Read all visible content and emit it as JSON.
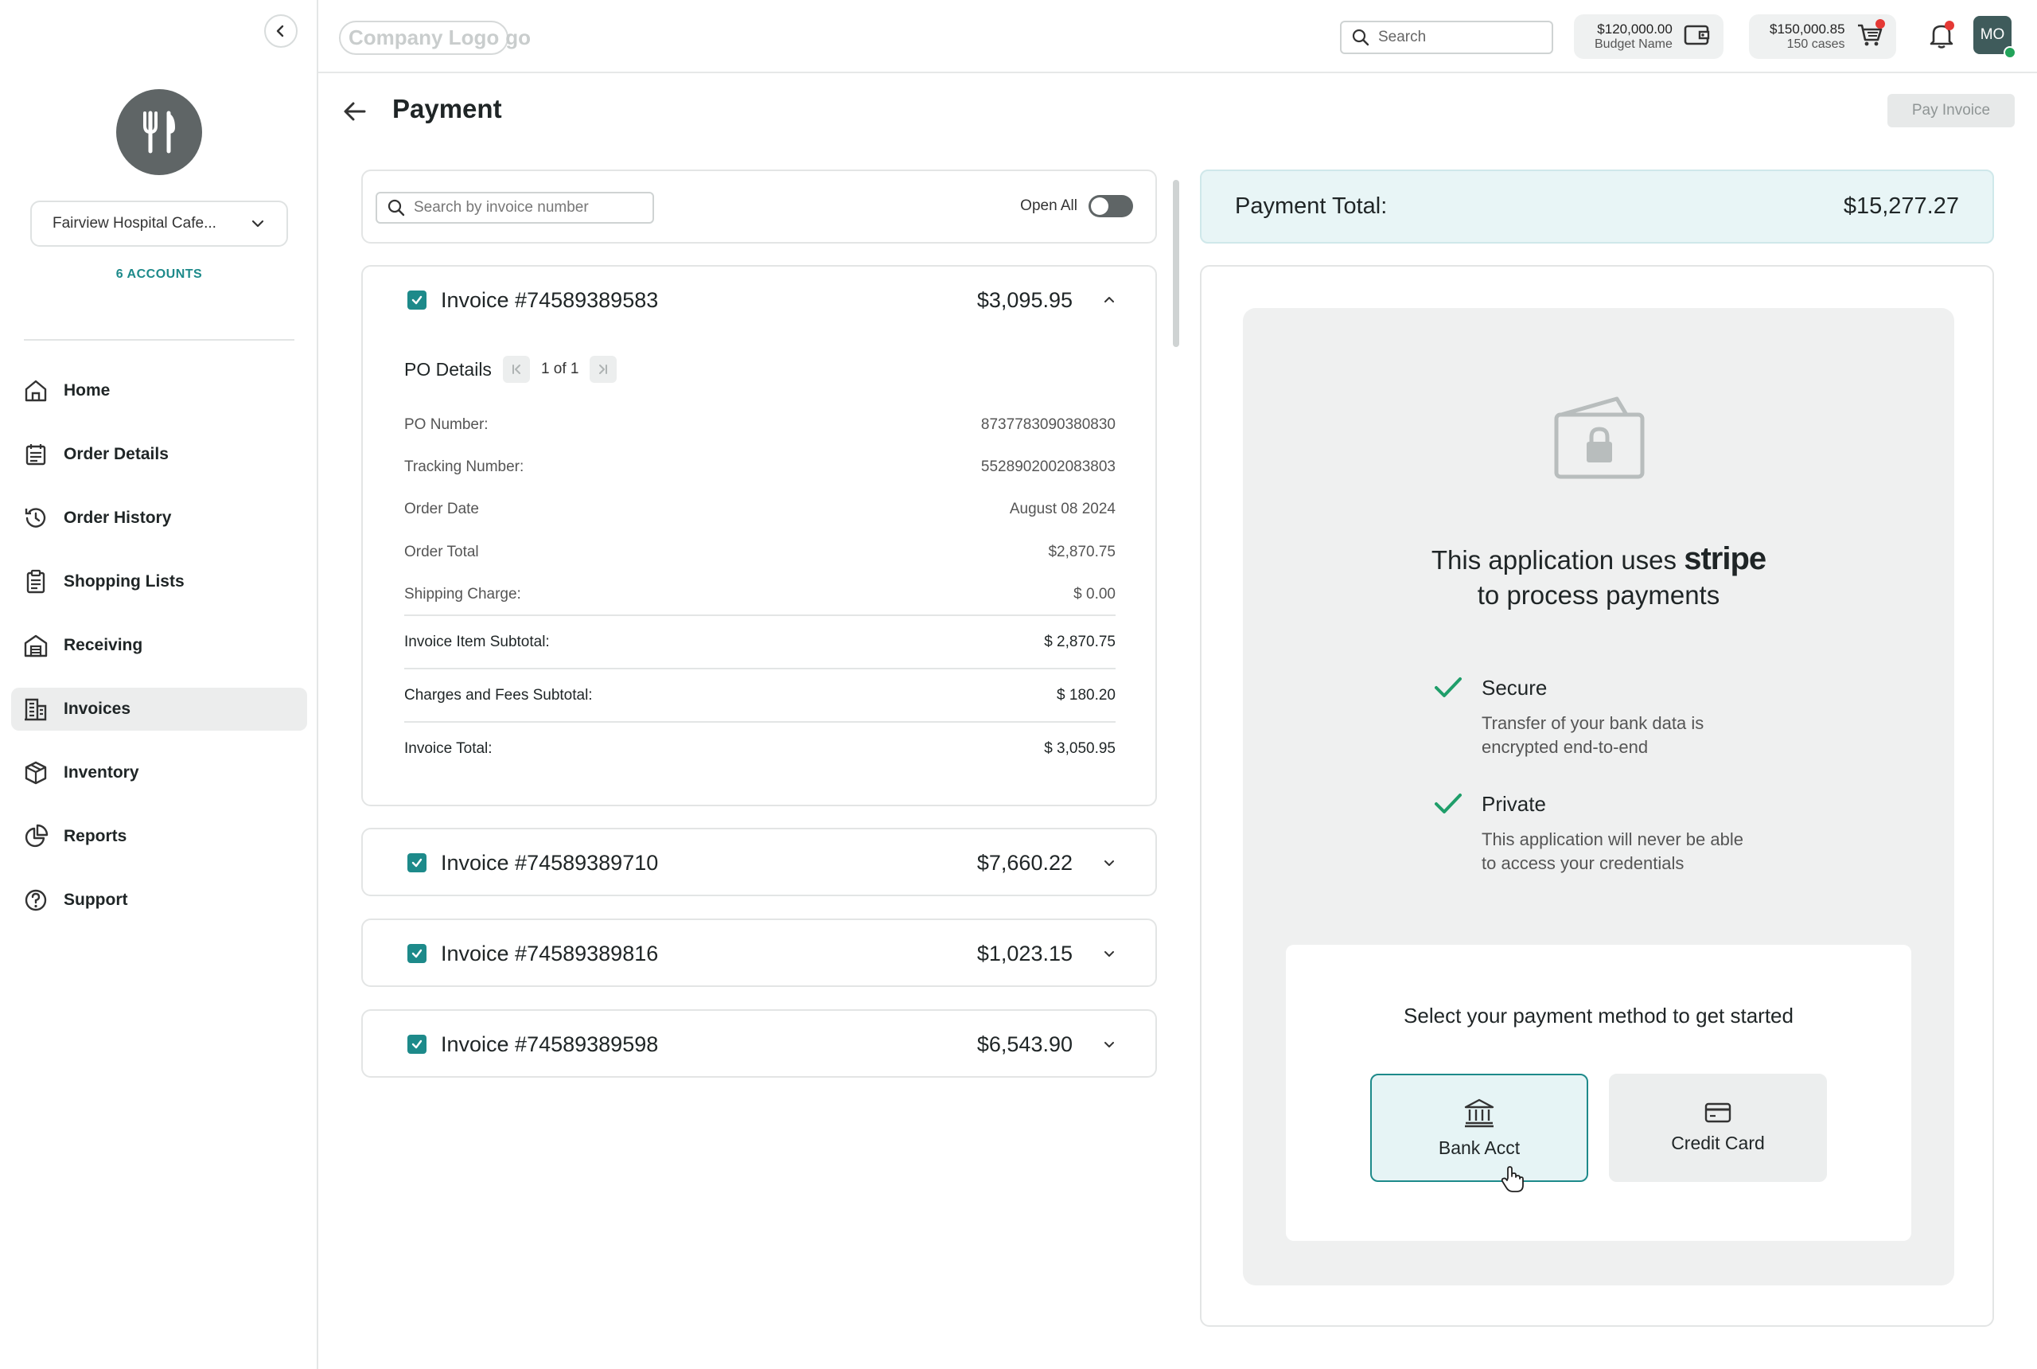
{
  "sidebar": {
    "account_name": "Fairview Hospital Cafe...",
    "accounts_count": "6 ACCOUNTS",
    "items": [
      {
        "label": "Home",
        "icon": "home-icon"
      },
      {
        "label": "Order Details",
        "icon": "calendar-list-icon"
      },
      {
        "label": "Order History",
        "icon": "history-icon"
      },
      {
        "label": "Shopping Lists",
        "icon": "clipboard-icon"
      },
      {
        "label": "Receiving",
        "icon": "warehouse-icon"
      },
      {
        "label": "Invoices",
        "icon": "invoice-icon",
        "active": true
      },
      {
        "label": "Inventory",
        "icon": "box-icon"
      },
      {
        "label": "Reports",
        "icon": "pie-chart-icon"
      },
      {
        "label": "Support",
        "icon": "help-circle-icon"
      }
    ]
  },
  "topbar": {
    "logo_text": "Company Logo",
    "logo_tail": "go",
    "search_placeholder": "Search",
    "budget": {
      "amount": "$120,000.00",
      "label": "Budget Name"
    },
    "cart": {
      "amount": "$150,000.85",
      "label": "150 cases"
    },
    "user_initials": "MO"
  },
  "page": {
    "title": "Payment",
    "pay_button": "Pay Invoice",
    "invoice_search_placeholder": "Search by invoice number",
    "open_all_label": "Open All"
  },
  "invoices": [
    {
      "number": "Invoice #74589389583",
      "amount": "$3,095.95",
      "expanded": true,
      "po_details": {
        "title": "PO Details",
        "pager": "1 of 1",
        "rows": [
          {
            "label": "PO Number:",
            "value": "8737783090380830"
          },
          {
            "label": "Tracking Number:",
            "value": "5528902002083803"
          },
          {
            "label": "Order Date",
            "value": "August 08 2024"
          },
          {
            "label": "Order Total",
            "value": "$2,870.75"
          },
          {
            "label": "Shipping Charge:",
            "value": "$ 0.00"
          }
        ],
        "subtotals": [
          {
            "label": "Invoice Item Subtotal:",
            "value": "$ 2,870.75"
          },
          {
            "label": "Charges and Fees Subtotal:",
            "value": "$ 180.20"
          },
          {
            "label": "Invoice Total:",
            "value": "$ 3,050.95"
          }
        ]
      }
    },
    {
      "number": "Invoice #74589389710",
      "amount": "$7,660.22",
      "expanded": false
    },
    {
      "number": "Invoice #74589389816",
      "amount": "$1,023.15",
      "expanded": false
    },
    {
      "number": "Invoice #74589389598",
      "amount": "$6,543.90",
      "expanded": false
    }
  ],
  "payment": {
    "total_label": "Payment Total:",
    "total_value": "$15,277.27",
    "stripe_pre": "This application uses",
    "stripe_word": "stripe",
    "stripe_post": "to process payments",
    "features": [
      {
        "title": "Secure",
        "desc": "Transfer of your bank data is encrypted end-to-end"
      },
      {
        "title": "Private",
        "desc": "This application will never be able to access your credentials"
      }
    ],
    "method_prompt": "Select your payment method to get started",
    "methods": [
      {
        "label": "Bank Acct",
        "icon": "bank-icon",
        "selected": true
      },
      {
        "label": "Credit Card",
        "icon": "credit-card-icon",
        "selected": false
      }
    ]
  },
  "colors": {
    "accent": "#1d8a8a",
    "accent_light": "#e6f4f5",
    "notification": "#e53935",
    "online": "#22a35a"
  }
}
